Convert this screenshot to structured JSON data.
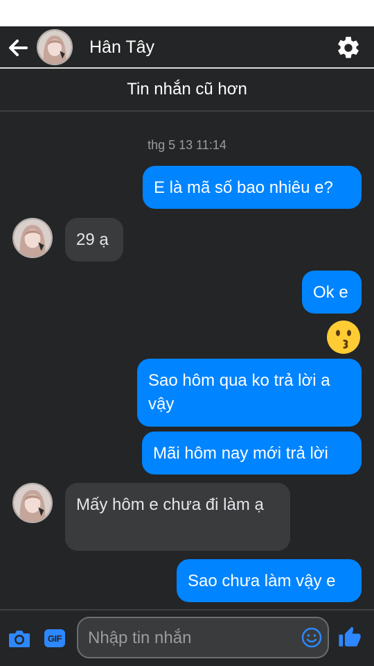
{
  "header": {
    "contact_name": "Hân Tây",
    "icons": [
      "arrow-left-icon",
      "gear-icon"
    ]
  },
  "older_messages_label": "Tin nhắn cũ hơn",
  "conversation": {
    "timestamp": "thg 5 13 11:14",
    "messages": [
      {
        "direction": "out",
        "text": "E là mã số bao nhiêu e?"
      },
      {
        "direction": "in",
        "text": "29 ạ"
      },
      {
        "direction": "out",
        "text": "Ok e"
      },
      {
        "direction": "out",
        "type": "emoji",
        "icon": "kissing-face-emoji"
      },
      {
        "direction": "out",
        "text": "Sao hôm qua ko trả lời a vậy"
      },
      {
        "direction": "out",
        "text": "Mãi hôm nay mới trả lời"
      },
      {
        "direction": "in",
        "text": "Mấy hôm e chưa đi làm ạ"
      },
      {
        "direction": "out",
        "text": "Sao chưa làm vậy e"
      }
    ]
  },
  "composer": {
    "placeholder": "Nhập tin nhắn",
    "gif_label": "GIF",
    "icons": [
      "camera-icon",
      "gif-icon",
      "smile-icon",
      "thumbs-up-icon"
    ]
  },
  "colors": {
    "background": "#242526",
    "outgoing_bubble": "#0084ff",
    "incoming_bubble": "#3a3b3c",
    "accent": "#2d88ff"
  }
}
